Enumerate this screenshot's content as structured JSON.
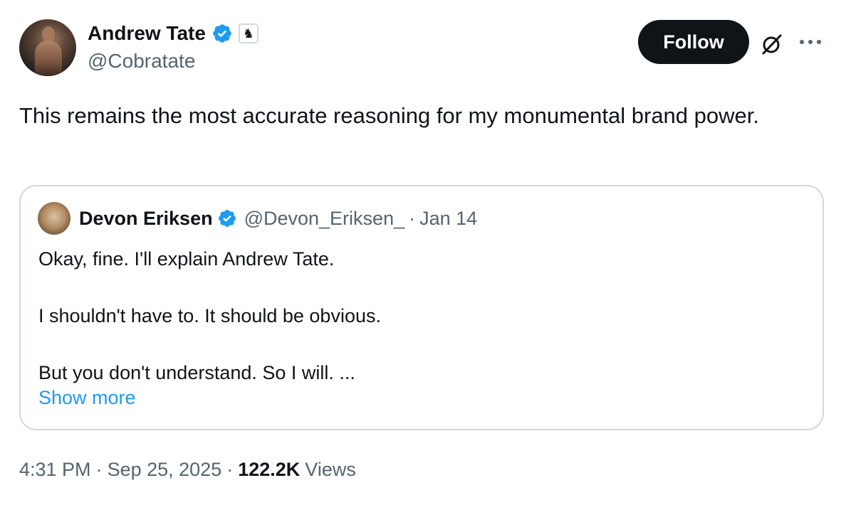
{
  "author": {
    "display_name": "Andrew Tate",
    "handle": "@Cobratate",
    "verified_color": "#1d9bf0",
    "affiliation_icon": "chess-knight-icon"
  },
  "actions": {
    "follow_label": "Follow",
    "grok_icon": "grok-icon",
    "more_icon": "more-options-icon"
  },
  "tweet": {
    "text": "This remains the most accurate reasoning for my monumental brand power."
  },
  "quote": {
    "display_name": "Devon Eriksen",
    "handle": "@Devon_Eriksen_",
    "separator": "·",
    "date": "Jan 14",
    "lines": [
      "Okay, fine. I'll explain Andrew Tate.",
      "I shouldn't have to. It should be obvious.",
      "But you don't understand. So I will. ..."
    ],
    "show_more_label": "Show more",
    "show_more_color": "#1d9bf0"
  },
  "footer": {
    "time": "4:31 PM",
    "sep1": "·",
    "date": "Sep 25, 2025",
    "sep2": "·",
    "views_count": "122.2K",
    "views_label": "Views"
  }
}
